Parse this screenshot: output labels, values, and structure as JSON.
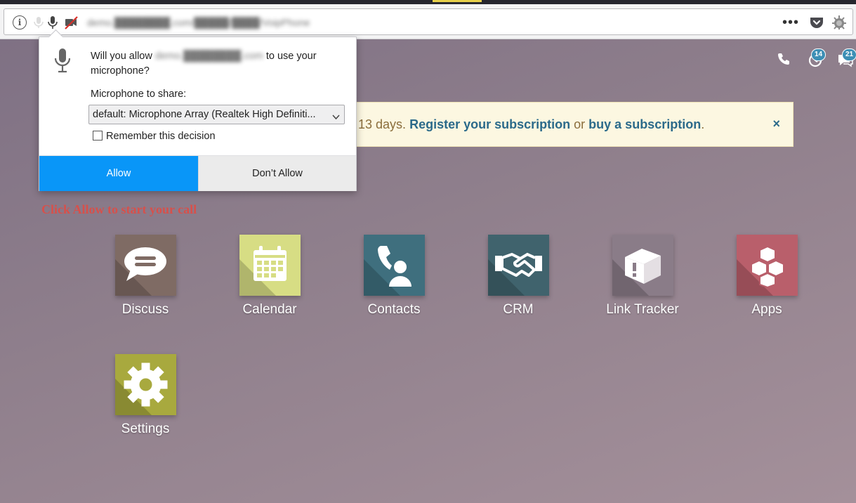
{
  "browser": {
    "url": "demo.████████.com/█████/████/VoipPhone",
    "more_icon": "ellipsis-icon",
    "info_icon": "i"
  },
  "permission_popup": {
    "question_prefix": "Will you allow",
    "question_host": "demo.████████.com",
    "question_suffix": "to use your microphone?",
    "share_label": "Microphone to share:",
    "selected_device": "default: Microphone Array (Realtek High Definiti...",
    "remember_label": "Remember this decision",
    "remember_checked": false,
    "allow_label": "Allow",
    "deny_label": "Don’t Allow",
    "allow_color": "#0996f8"
  },
  "nav": {
    "activity_count": "14",
    "chat_count": "21"
  },
  "banner": {
    "text_prefix": "n 13 days.",
    "register_link": "Register your subscription",
    "or_text": "or",
    "buy_link": "buy a subscription",
    "period": ".",
    "close": "×"
  },
  "instruction": "Click Allow to start your call",
  "apps": [
    {
      "label": "Discuss",
      "color": "#7f6b64",
      "icon": "chat-bubble-icon"
    },
    {
      "label": "Calendar",
      "color": "#d7dd84",
      "icon": "calendar-icon"
    },
    {
      "label": "Contacts",
      "color": "#3f6f7e",
      "icon": "contact-phone-icon"
    },
    {
      "label": "CRM",
      "color": "#40636d",
      "icon": "handshake-icon"
    },
    {
      "label": "Link Tracker",
      "color": "#8a7c88",
      "icon": "box-icon"
    },
    {
      "label": "Apps",
      "color": "#b95f6b",
      "icon": "cubes-icon"
    },
    {
      "label": "Settings",
      "color": "#a8a93e",
      "icon": "gear-icon"
    }
  ]
}
